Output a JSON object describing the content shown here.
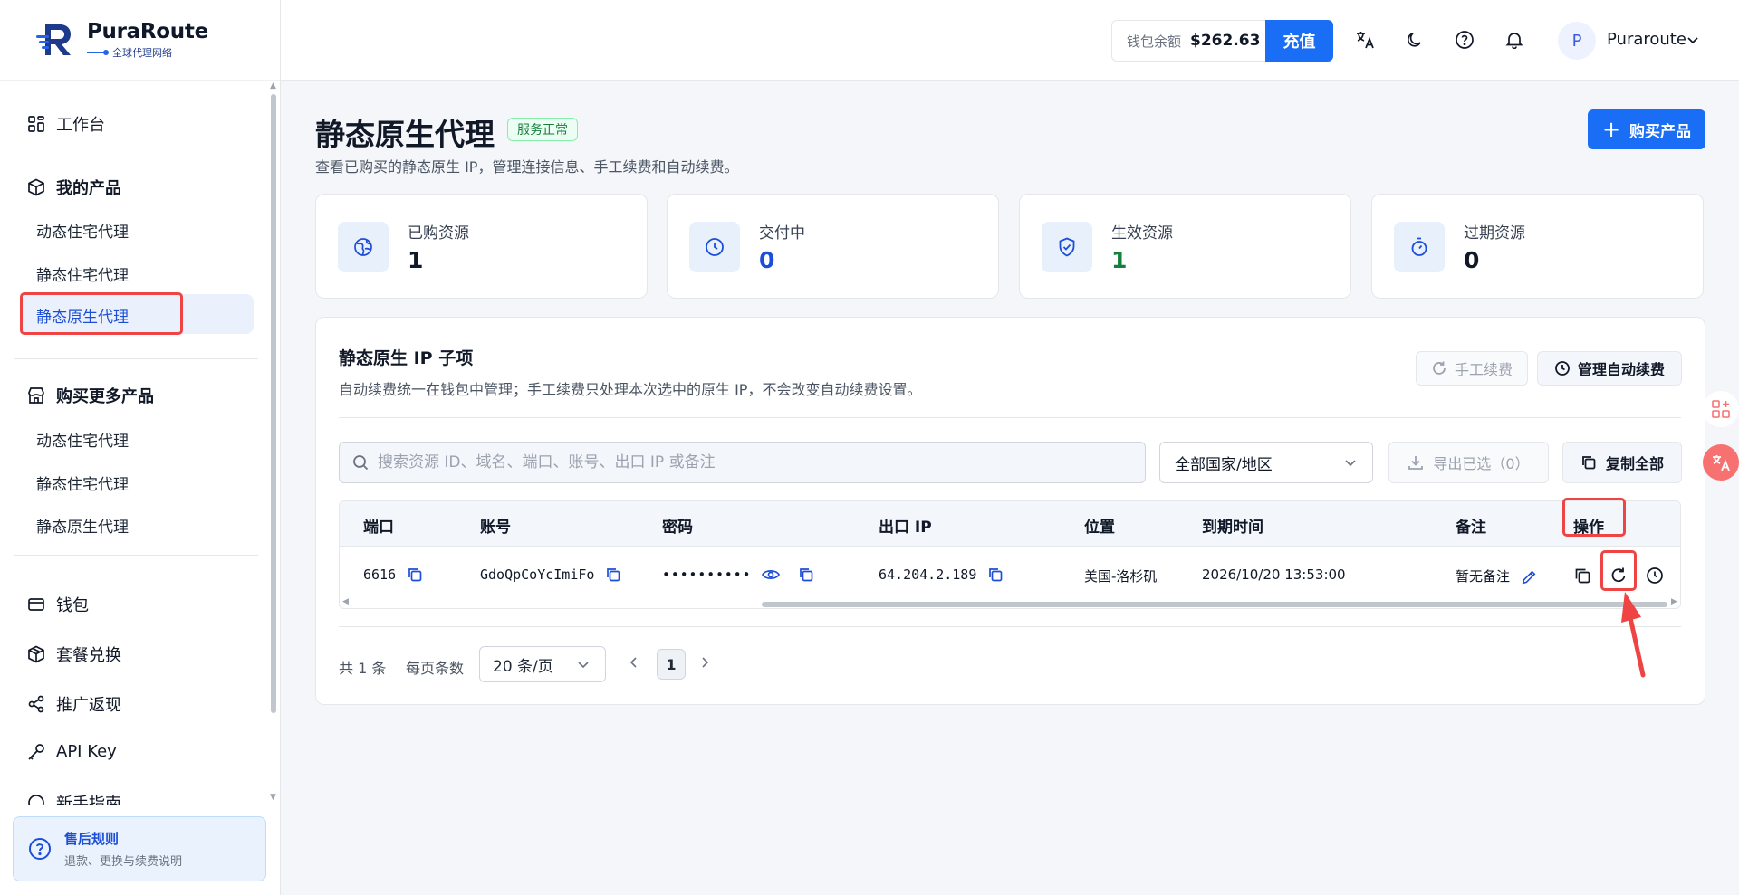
{
  "brand": {
    "name": "PuraRoute",
    "tagline": "全球代理网络"
  },
  "sidebar": {
    "workbench": "工作台",
    "my_products": "我的产品",
    "my_products_items": [
      "动态住宅代理",
      "静态住宅代理",
      "静态原生代理"
    ],
    "buy_more": "购买更多产品",
    "buy_more_items": [
      "动态住宅代理",
      "静态住宅代理",
      "静态原生代理"
    ],
    "wallet": "钱包",
    "redeem": "套餐兑换",
    "referral": "推广返现",
    "api_key": "API Key",
    "guide": "新手指南",
    "help_title": "售后规则",
    "help_sub": "退款、更换与续费说明"
  },
  "header": {
    "wallet_label": "钱包余额",
    "wallet_amount": "$262.63",
    "recharge": "充值",
    "avatar_initial": "P",
    "user_name": "Puraroute"
  },
  "page": {
    "title": "静态原生代理",
    "status": "服务正常",
    "subtitle": "查看已购买的静态原生 IP，管理连接信息、手工续费和自动续费。",
    "buy_button": "购买产品"
  },
  "stats": [
    {
      "label": "已购资源",
      "value": "1",
      "color": "#111827"
    },
    {
      "label": "交付中",
      "value": "0",
      "color": "#1d4ed8"
    },
    {
      "label": "生效资源",
      "value": "1",
      "color": "#15803d"
    },
    {
      "label": "过期资源",
      "value": "0",
      "color": "#111827"
    }
  ],
  "panel": {
    "title": "静态原生 IP 子项",
    "subtitle": "自动续费统一在钱包中管理；手工续费只处理本次选中的原生 IP，不会改变自动续费设置。",
    "manual_renew": "手工续费",
    "manage_auto_renew": "管理自动续费",
    "search_placeholder": "搜索资源 ID、域名、端口、账号、出口 IP 或备注",
    "country_select": "全部国家/地区",
    "export_selected": "导出已选（0）",
    "copy_all": "复制全部"
  },
  "table": {
    "headers": [
      "端口",
      "账号",
      "密码",
      "出口 IP",
      "位置",
      "到期时间",
      "备注",
      "操作"
    ],
    "row": {
      "port": "6616",
      "account": "GdoQpCoYcImiFo",
      "password": "••••••••••",
      "ip": "64.204.2.189",
      "location": "美国-洛杉矶",
      "expiry": "2026/10/20 13:53:00",
      "note": "暂无备注"
    }
  },
  "pager": {
    "total": "共 1 条",
    "size_label": "每页条数",
    "size_value": "20 条/页",
    "page": "1"
  },
  "colors": {
    "accent": "#1a6ef5",
    "highlight": "#ef4444"
  }
}
